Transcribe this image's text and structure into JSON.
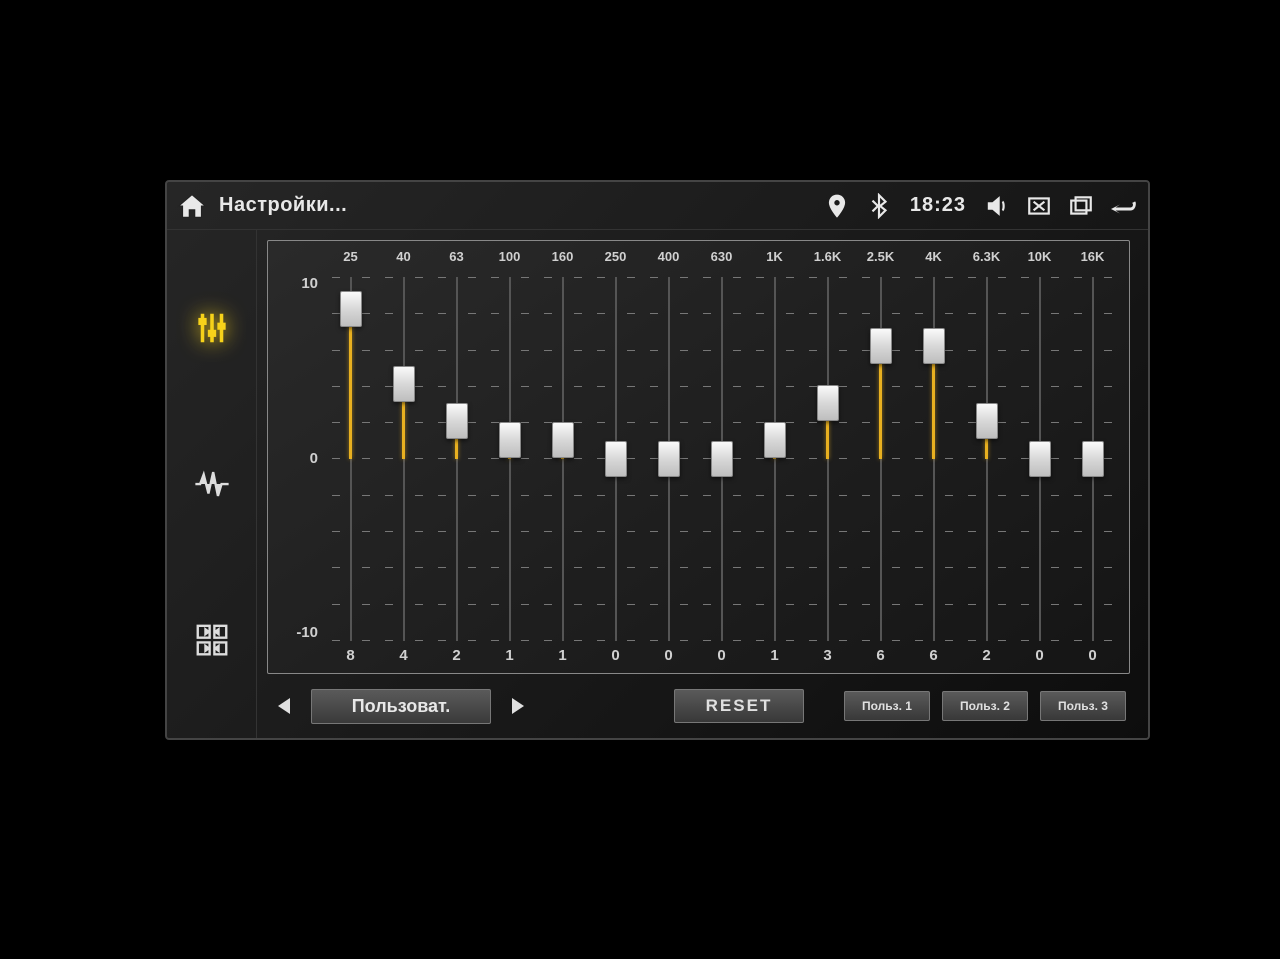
{
  "header": {
    "title": "Настройки...",
    "clock": "18:23"
  },
  "scale": {
    "max": "10",
    "mid": "0",
    "min": "-10"
  },
  "eq": {
    "range_min": -10,
    "range_max": 10,
    "bands": [
      {
        "freq": "25",
        "value": 8
      },
      {
        "freq": "40",
        "value": 4
      },
      {
        "freq": "63",
        "value": 2
      },
      {
        "freq": "100",
        "value": 1
      },
      {
        "freq": "160",
        "value": 1
      },
      {
        "freq": "250",
        "value": 0
      },
      {
        "freq": "400",
        "value": 0
      },
      {
        "freq": "630",
        "value": 0
      },
      {
        "freq": "1K",
        "value": 1
      },
      {
        "freq": "1.6K",
        "value": 3
      },
      {
        "freq": "2.5K",
        "value": 6
      },
      {
        "freq": "4K",
        "value": 6
      },
      {
        "freq": "6.3K",
        "value": 2
      },
      {
        "freq": "10K",
        "value": 0
      },
      {
        "freq": "16K",
        "value": 0
      }
    ]
  },
  "controls": {
    "preset_selected": "Пользоват.",
    "reset_label": "RESET",
    "user_presets": [
      "Польз. 1",
      "Польз. 2",
      "Польз. 3"
    ]
  },
  "colors": {
    "accent": "#f7d21a",
    "slider_fill": "#e8b020"
  }
}
